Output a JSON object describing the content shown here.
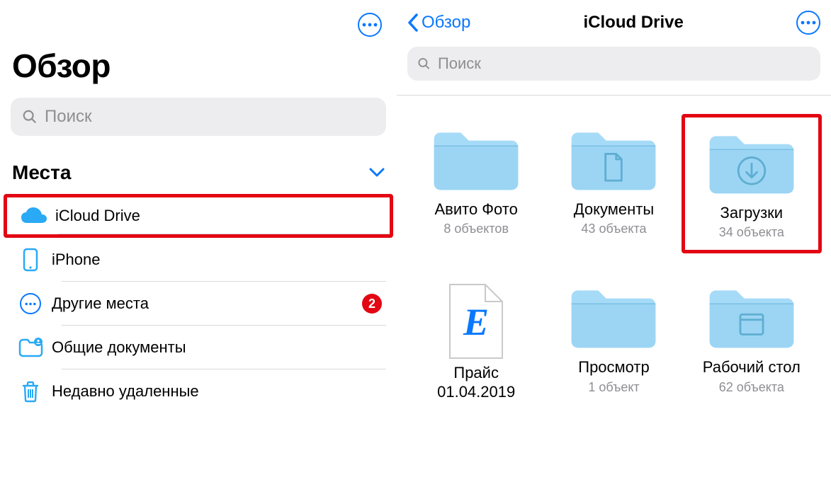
{
  "left": {
    "title": "Обзор",
    "search_placeholder": "Поиск",
    "section_title": "Места",
    "locations": [
      {
        "label": "iCloud Drive",
        "highlighted": true
      },
      {
        "label": "iPhone"
      },
      {
        "label": "Другие места",
        "badge": "2"
      },
      {
        "label": "Общие документы"
      },
      {
        "label": "Недавно удаленные"
      }
    ]
  },
  "right": {
    "back_label": "Обзор",
    "title": "iCloud Drive",
    "search_placeholder": "Поиск",
    "items": [
      {
        "kind": "folder",
        "name": "Авито Фото",
        "subtitle": "8 объектов"
      },
      {
        "kind": "folder-doc",
        "name": "Документы",
        "subtitle": "43 объекта"
      },
      {
        "kind": "folder-down",
        "name": "Загрузки",
        "subtitle": "34 объекта",
        "highlighted": true
      },
      {
        "kind": "file-e",
        "name": "Прайс 01.04.2019",
        "subtitle": ""
      },
      {
        "kind": "folder",
        "name": "Просмотр",
        "subtitle": "1 объект"
      },
      {
        "kind": "folder-app",
        "name": "Рабочий стол",
        "subtitle": "62 объекта"
      }
    ]
  }
}
